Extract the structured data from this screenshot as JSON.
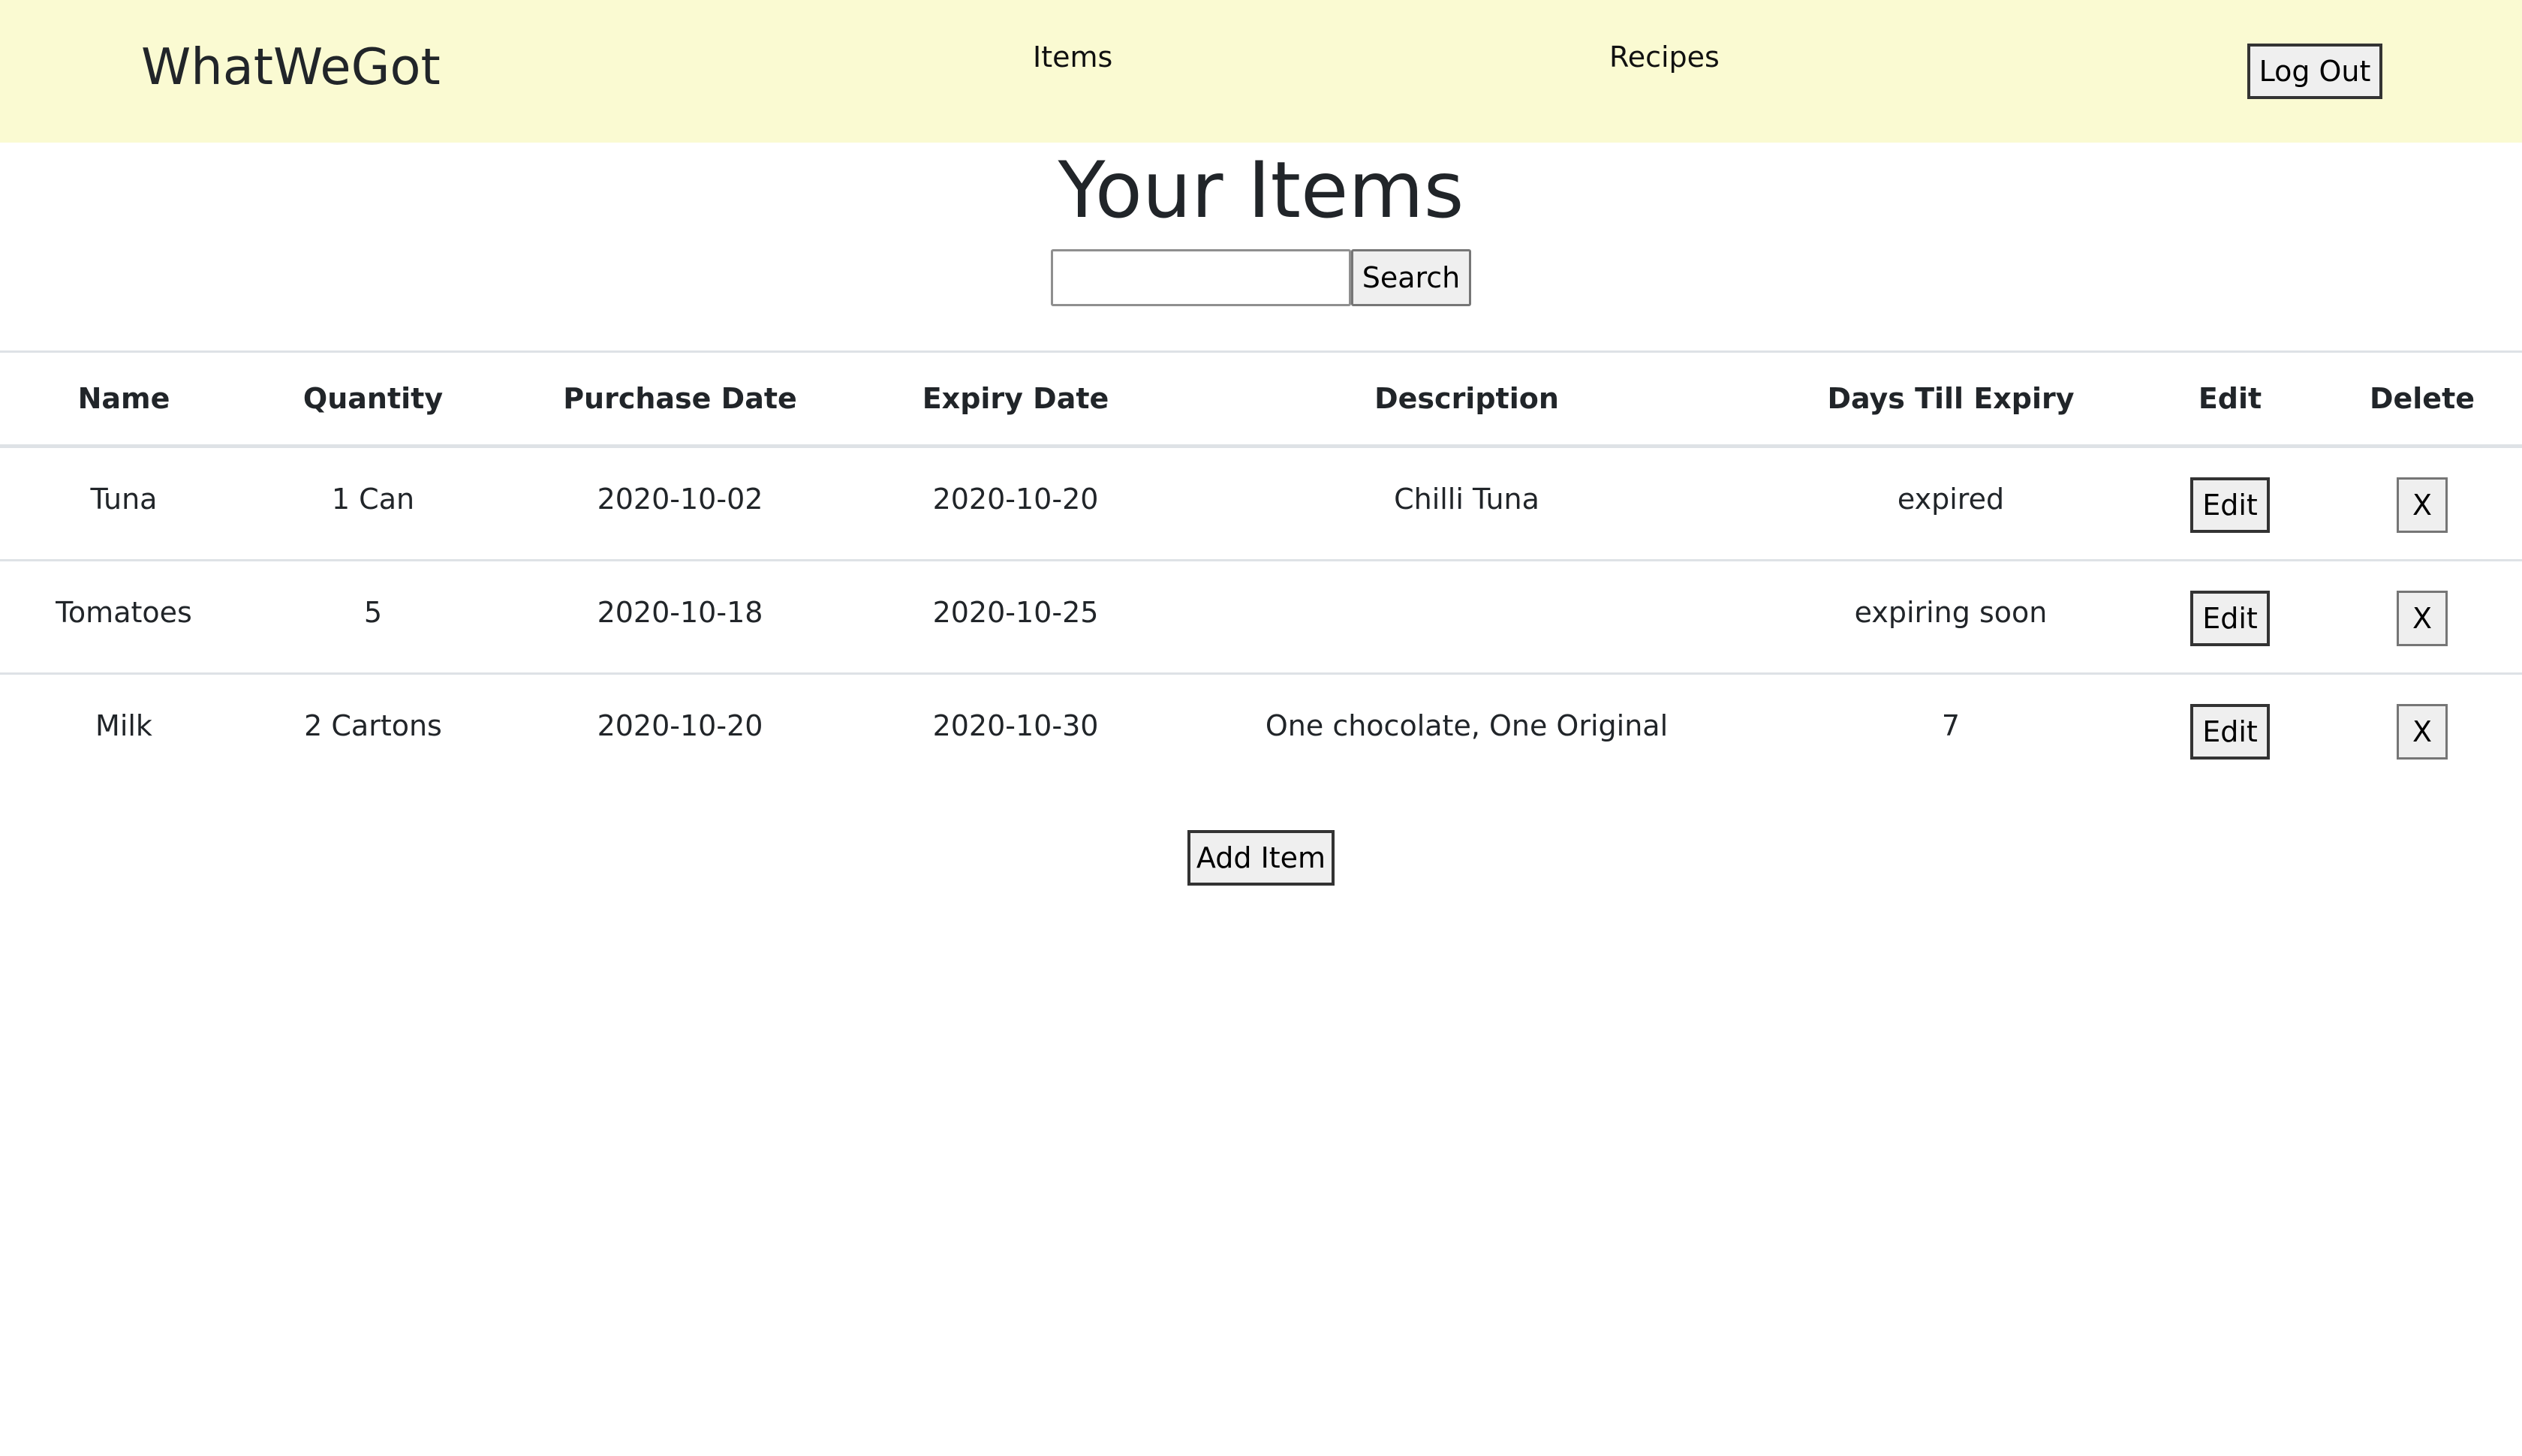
{
  "navbar": {
    "brand": "WhatWeGot",
    "links": [
      {
        "label": "Items"
      },
      {
        "label": "Recipes"
      }
    ],
    "logout_label": "Log Out"
  },
  "page": {
    "title": "Your Items"
  },
  "search": {
    "value": "",
    "placeholder": "",
    "button_label": "Search"
  },
  "table": {
    "columns": [
      "Name",
      "Quantity",
      "Purchase Date",
      "Expiry Date",
      "Description",
      "Days Till Expiry",
      "Edit",
      "Delete"
    ],
    "rows": [
      {
        "name": "Tuna",
        "quantity": "1 Can",
        "purchase_date": "2020-10-02",
        "expiry_date": "2020-10-20",
        "description": "Chilli Tuna",
        "days_till_expiry": "expired",
        "edit_label": "Edit",
        "delete_label": "X"
      },
      {
        "name": "Tomatoes",
        "quantity": "5",
        "purchase_date": "2020-10-18",
        "expiry_date": "2020-10-25",
        "description": "",
        "days_till_expiry": "expiring soon",
        "edit_label": "Edit",
        "delete_label": "X"
      },
      {
        "name": "Milk",
        "quantity": "2 Cartons",
        "purchase_date": "2020-10-20",
        "expiry_date": "2020-10-30",
        "description": "One chocolate, One Original",
        "days_till_expiry": "7",
        "edit_label": "Edit",
        "delete_label": "X"
      }
    ]
  },
  "add_item_label": "Add Item",
  "colors": {
    "navbar_background": "#fafad2",
    "text": "#212529",
    "border": "#dee2e6",
    "button_background": "#efefef"
  }
}
